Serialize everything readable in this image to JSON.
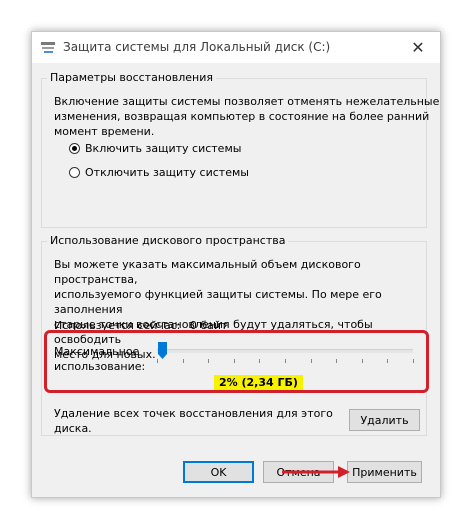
{
  "window": {
    "title": "Защита системы для Локальный диск (C:)",
    "close_symbol": "✕"
  },
  "restore_group": {
    "legend": "Параметры восстановления",
    "description_lines": [
      "Включение защиты системы позволяет отменять нежелательные",
      "изменения, возвращая компьютер в состояние на более ранний",
      "момент времени."
    ],
    "options": [
      {
        "label": "Включить защиту системы",
        "checked": true
      },
      {
        "label": "Отключить защиту системы",
        "checked": false
      }
    ]
  },
  "disk_group": {
    "legend": "Использование дискового пространства",
    "description_lines": [
      "Вы можете указать максимальный объем дискового пространства,",
      "используемого функцией защиты системы. По мере его заполнения",
      "старые точки восстановления будут удаляться, чтобы освободить",
      "место для новых."
    ],
    "current_usage_label": "Используется сейчас:",
    "current_usage_value": "0 байт",
    "max_usage_label_line1": "Максимальное",
    "max_usage_label_line2": "использование:",
    "slider_value": "2% (2,34 ГБ)",
    "slider_fraction": 0.02,
    "delete_text_line1": "Удаление всех точек восстановления для этого",
    "delete_text_line2": "диска.",
    "delete_button": "Удалить"
  },
  "footer": {
    "ok": "OK",
    "cancel": "Отмена",
    "apply": "Применить"
  },
  "colors": {
    "highlight": "#f6f200",
    "annotation_red": "#d2202a",
    "slider_thumb": "#0078d7"
  }
}
